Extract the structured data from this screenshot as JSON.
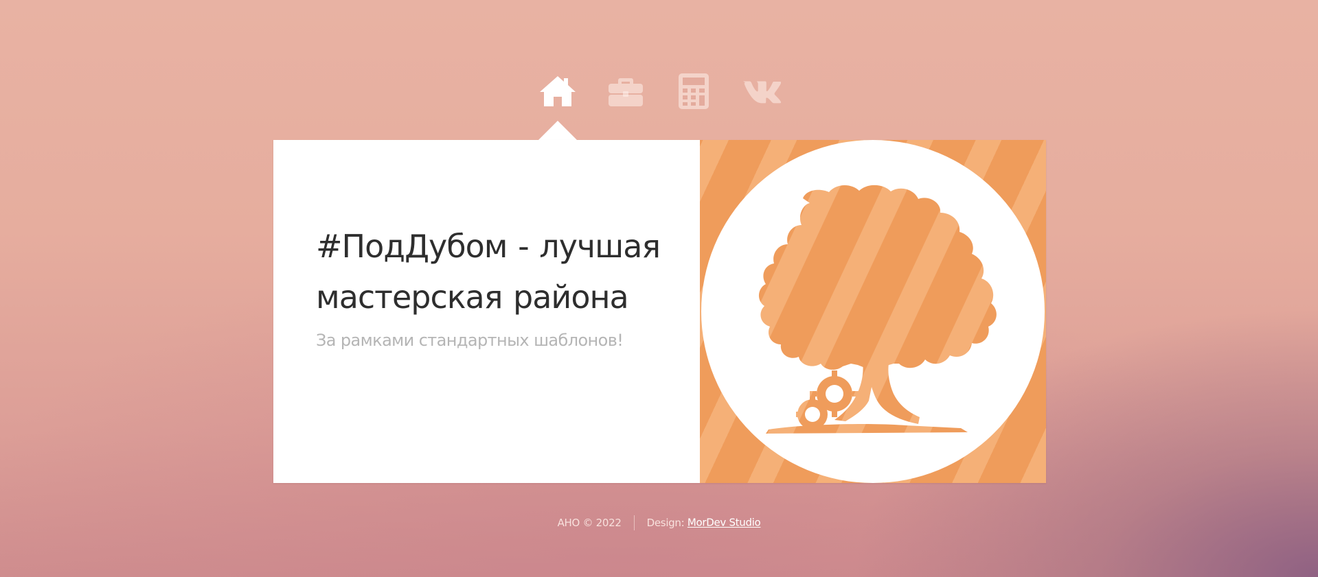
{
  "nav": {
    "items": [
      {
        "icon": "home-icon",
        "active": true
      },
      {
        "icon": "briefcase-icon",
        "active": false
      },
      {
        "icon": "calculator-icon",
        "active": false
      },
      {
        "icon": "vk-icon",
        "active": false
      }
    ]
  },
  "hero": {
    "title": "#ПодДубом - лучшая мастерская района",
    "subtitle": "За рамками стандартных шаблонов!"
  },
  "footer": {
    "copyright": "АНО © 2022",
    "design_label": "Design:",
    "design_link": "MorDev Studio"
  },
  "colors": {
    "accent_orange": "#ef9c5b",
    "accent_orange_light": "#f5b077",
    "title_text": "#2e2e2e",
    "subtitle_text": "#b5b5b5"
  }
}
